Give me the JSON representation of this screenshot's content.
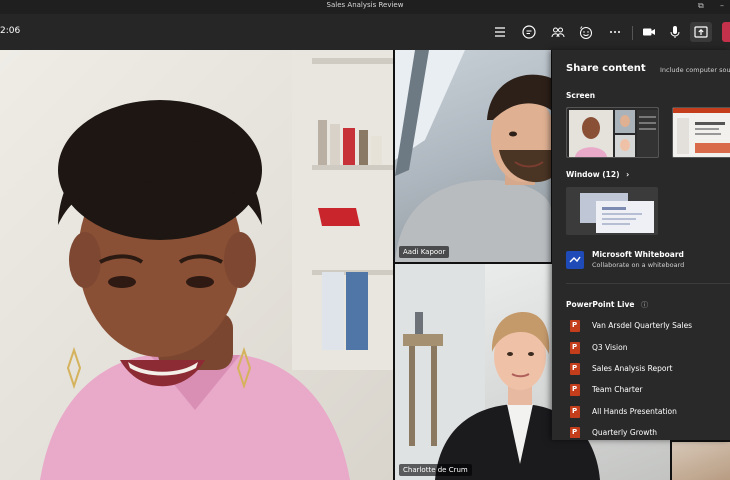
{
  "window": {
    "title": "Sales Analysis Review"
  },
  "toolbar": {
    "timer": "2:06",
    "icons": [
      "list-icon",
      "chat-icon",
      "people-icon",
      "react-icon",
      "more-icon",
      "camera-icon",
      "mic-icon",
      "share-icon",
      "leave-icon"
    ]
  },
  "participants": [
    {
      "name": "Aadi Kapoor"
    },
    {
      "name": "Charlotte de Crum"
    }
  ],
  "share_panel": {
    "title": "Share content",
    "sound_option": "Include computer sound",
    "screen_label": "Screen",
    "window_label": "Window (12)",
    "whiteboard": {
      "title": "Microsoft Whiteboard",
      "subtitle": "Collaborate on a whiteboard"
    },
    "ppt_label": "PowerPoint Live",
    "ppt_items": [
      "Van Arsdel Quarterly Sales",
      "Q3 Vision",
      "Sales Analysis Report",
      "Team Charter",
      "All Hands Presentation",
      "Quarterly Growth"
    ]
  },
  "colors": {
    "leave": "#c4314b",
    "whiteboard": "#1e4bb8",
    "powerpoint": "#c43e1c"
  }
}
